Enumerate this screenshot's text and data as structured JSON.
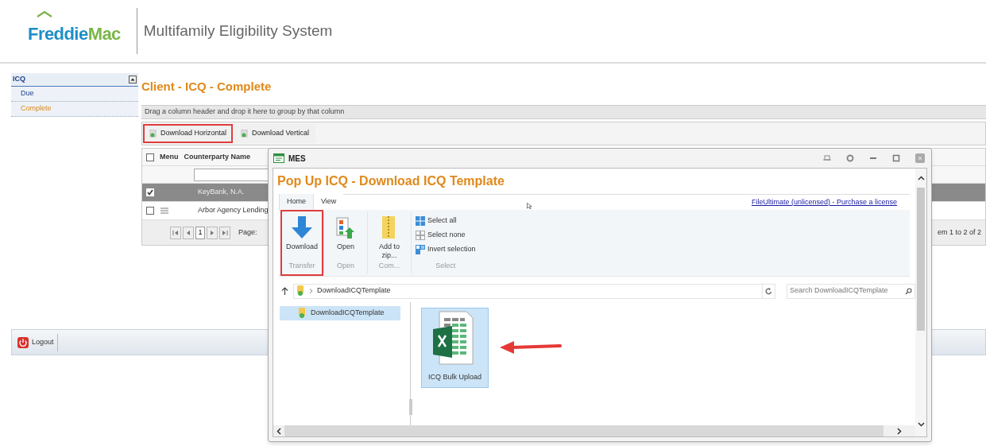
{
  "header": {
    "logo": {
      "part_1": "Freddie",
      "part_2": "Mac"
    },
    "app_title": "Multifamily Eligibility System"
  },
  "sidebar": {
    "section": "ICQ",
    "items": [
      {
        "label": "Due",
        "selected": false
      },
      {
        "label": "Complete",
        "selected": true
      }
    ]
  },
  "main": {
    "title": "Client - ICQ - Complete",
    "group_hint": "Drag a column header and drop it here to group by that column",
    "toolbar": [
      {
        "label": "Download Horizontal",
        "highlighted": true
      },
      {
        "label": "Download Vertical",
        "highlighted": false
      }
    ],
    "grid": {
      "header_checked": false,
      "columns": [
        "Menu",
        "Counterparty Name"
      ],
      "rows": [
        {
          "name": "KeyBank, N.A.",
          "checked": true,
          "selected": true
        },
        {
          "name": "Arbor Agency Lending",
          "checked": false,
          "selected": false
        }
      ],
      "pager": {
        "page": "1",
        "page_label": "Page:",
        "summary": "em 1 to 2 of 2"
      }
    }
  },
  "footer": {
    "logout": "Logout"
  },
  "popup": {
    "title": "MES",
    "heading": "Pop Up ICQ - Download ICQ Template",
    "ribbon": {
      "tabs": [
        {
          "label": "Home",
          "selected": true
        },
        {
          "label": "View",
          "selected": false
        }
      ],
      "license_link": "FileUltimate (unlicensed) - Purchase a license",
      "groups": [
        {
          "label": "Transfer",
          "highlighted": true,
          "buttons": [
            {
              "label": "Download",
              "kind": "download"
            }
          ]
        },
        {
          "label": "Open",
          "highlighted": false,
          "buttons": [
            {
              "label": "Open",
              "kind": "open"
            }
          ]
        },
        {
          "label": "Com...",
          "highlighted": false,
          "buttons": [
            {
              "label": "Add to zip...",
              "kind": "zip"
            }
          ]
        },
        {
          "label": "Select",
          "highlighted": false,
          "buttons": [
            {
              "label": "Select all",
              "kind": "select_all"
            },
            {
              "label": "Select none",
              "kind": "select_none"
            },
            {
              "label": "Invert selection",
              "kind": "invert"
            }
          ]
        }
      ]
    },
    "path": "DownloadICQTemplate",
    "search": {
      "placeholder": "Search DownloadICQTemplate"
    },
    "tree": [
      {
        "label": "DownloadICQTemplate",
        "selected": true
      }
    ],
    "files": [
      {
        "label": "ICQ Bulk Upload",
        "selected": true
      }
    ]
  }
}
